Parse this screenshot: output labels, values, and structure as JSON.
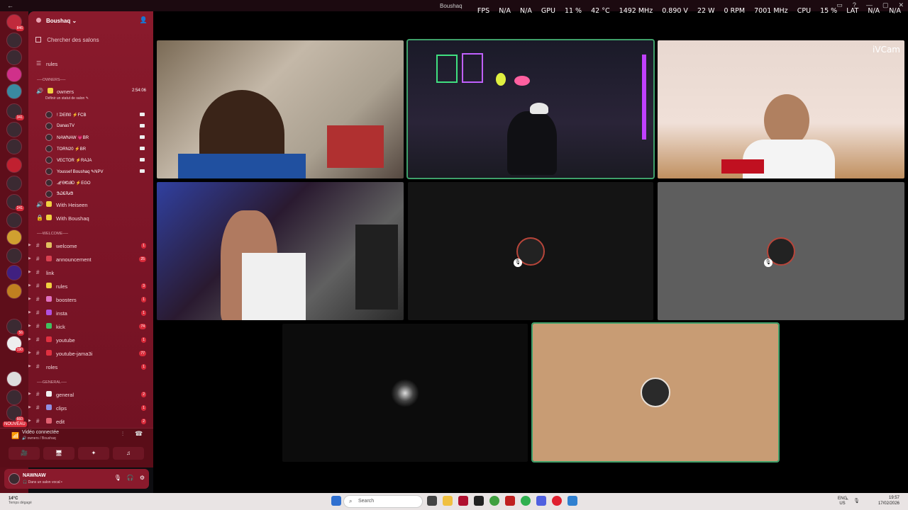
{
  "window": {
    "title": "Boushaq"
  },
  "overlay": {
    "fps_label": "FPS",
    "fps": "N/A",
    "fps2": "N/A",
    "gpu_label": "GPU",
    "gpu_usage": "11 %",
    "gpu_temp": "42 °C",
    "gpu_clock": "1492 MHz",
    "gpu_volt": "0.890 V",
    "gpu_power": "22 W",
    "gpu_fan": "0 RPM",
    "gpu_mem": "7001 MHz",
    "cpu_label": "CPU",
    "cpu_usage": "15 %",
    "lat_label": "LAT",
    "lat": "N/A",
    "lat2": "N/A"
  },
  "rail": {
    "top_badge": "846",
    "badges": [
      "341",
      "241",
      "56",
      "190",
      "660"
    ],
    "nouveau": "NOUVEAU"
  },
  "server": {
    "name": "Boushaq ⌄"
  },
  "search": {
    "placeholder": "Chercher des salons"
  },
  "channels_top": [
    {
      "name": "rules"
    }
  ],
  "categories": {
    "owners": "──OWNERS──",
    "welcome": "──WELCOME──",
    "general": "──GENERAL──"
  },
  "voice_channel": {
    "name": "owners",
    "time": "2:54:06",
    "hint": "Définir un statut de salon ✎"
  },
  "members": [
    {
      "name": "! ᗪᗴᗰ0 ⚡FCB",
      "cam": true
    },
    {
      "name": "DanasTV",
      "cam": true
    },
    {
      "name": "NAWNAW 💗BR",
      "cam": true
    },
    {
      "name": "TORN20 ⚡BR",
      "cam": true
    },
    {
      "name": "VECTOR ⚡RAJA",
      "cam": true
    },
    {
      "name": "Youssef Boushaq ✎NPV",
      "cam": true
    },
    {
      "name": "ℳᎾᏬᎯᎠ ⚡EGO",
      "cam": false
    },
    {
      "name": "ᏕᏇᏋᏒᏗᏕ",
      "cam": false
    }
  ],
  "locked_voice": [
    {
      "name": "With Heiseen"
    },
    {
      "name": "With Boushaq"
    }
  ],
  "text_channels": [
    {
      "name": "welcome",
      "badge": "1",
      "color": "#e0c060"
    },
    {
      "name": "announcement",
      "badge": "25",
      "color": "#d94050"
    },
    {
      "name": "link",
      "badge": "",
      "color": ""
    },
    {
      "name": "rules",
      "badge": "3",
      "color": "#f0d040"
    },
    {
      "name": "boosters",
      "badge": "1",
      "color": "#e070c0"
    },
    {
      "name": "insta",
      "badge": "1",
      "color": "#b050e0"
    },
    {
      "name": "kick",
      "badge": "74",
      "color": "#40c060"
    },
    {
      "name": "youtube",
      "badge": "1",
      "color": "#e03040"
    },
    {
      "name": "youtube-jama3i",
      "badge": "77",
      "color": "#e03040"
    },
    {
      "name": "roles",
      "badge": "1",
      "color": ""
    }
  ],
  "general_channels": [
    {
      "name": "general",
      "badge": "2",
      "color": "#f0f0f0"
    },
    {
      "name": "clips",
      "badge": "1",
      "color": "#9090e0"
    },
    {
      "name": "edit",
      "badge": "2",
      "color": "#e06070"
    }
  ],
  "voice_panel": {
    "status": "Vidéo connectée",
    "sub": "🔊 owners / Boushaq"
  },
  "user": {
    "name": "NAWNAW",
    "status": "🎧 Dans un salon vocal •"
  },
  "tiles": {
    "watermark": "iVCam"
  },
  "taskbar": {
    "weather_temp": "14°C",
    "weather_desc": "Temps dégagé",
    "search": "Search",
    "lang": "ENG",
    "region": "US",
    "time": "19:57",
    "date": "17/02/2026"
  }
}
